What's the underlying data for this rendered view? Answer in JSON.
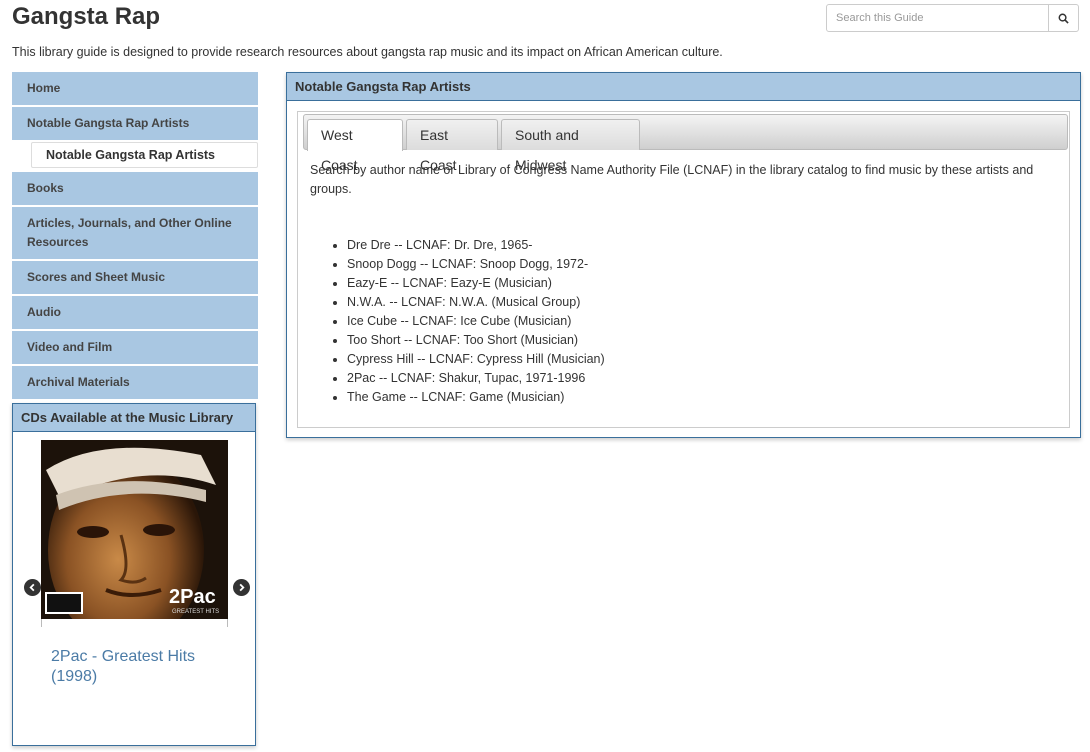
{
  "header": {
    "title": "Gangsta Rap",
    "search_placeholder": "Search this Guide",
    "description": "This library guide is designed to provide research resources about gangsta rap music and its impact on African American culture."
  },
  "sidebar": {
    "items": [
      {
        "label": "Home"
      },
      {
        "label": "Notable Gangsta Rap Artists"
      },
      {
        "label": "Books"
      },
      {
        "label": "Articles, Journals, and Other Online Resources"
      },
      {
        "label": "Scores and Sheet Music"
      },
      {
        "label": "Audio"
      },
      {
        "label": "Video and Film"
      },
      {
        "label": "Archival Materials"
      }
    ],
    "subitem": "Notable Gangsta Rap Artists"
  },
  "cd_box": {
    "title": "CDs Available at the Music Library",
    "album_logo": "2Pac",
    "album_sub": "GREATEST HITS",
    "cd_title": "2Pac - Greatest Hits (1998)"
  },
  "main": {
    "title": "Notable Gangsta Rap Artists",
    "tabs": [
      "West Coast",
      "East Coast",
      "South and Midwest"
    ],
    "intro": "Search by author name or Library of Congress Name Authority File (LCNAF) in the library catalog to find music by these artists and groups.",
    "artists": [
      "Dre Dre -- LCNAF: Dr. Dre, 1965-",
      "Snoop Dogg -- LCNAF: Snoop Dogg, 1972-",
      "Eazy-E -- LCNAF: Eazy-E (Musician)",
      "N.W.A. -- LCNAF: N.W.A. (Musical Group)",
      "Ice Cube -- LCNAF: Ice Cube (Musician)",
      "Too Short -- LCNAF: Too Short (Musician)",
      "Cypress Hill -- LCNAF: Cypress Hill (Musician)",
      "2Pac -- LCNAF: Shakur, Tupac, 1971-1996",
      "The Game -- LCNAF: Game (Musician)"
    ]
  },
  "colors": {
    "nav_bg": "#a9c7e2",
    "box_border": "#3a6f9b",
    "link": "#4b7ba6"
  }
}
